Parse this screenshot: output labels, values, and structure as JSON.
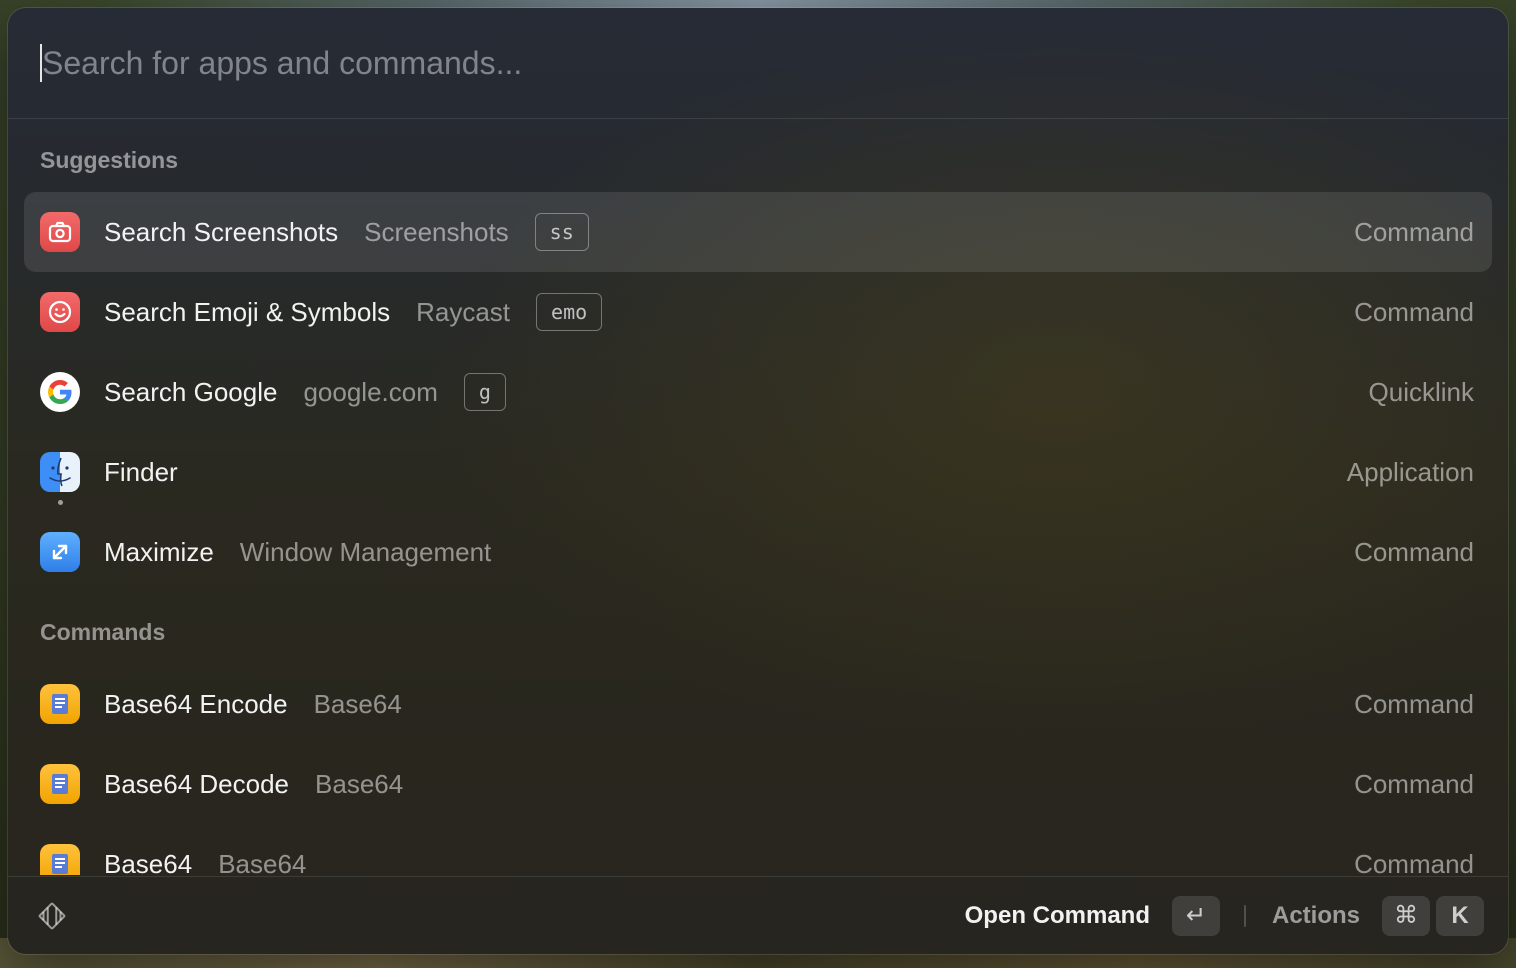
{
  "search": {
    "placeholder": "Search for apps and commands..."
  },
  "sections": {
    "suggestions_title": "Suggestions",
    "commands_title": "Commands"
  },
  "suggestions": [
    {
      "title": "Search Screenshots",
      "subtitle": "Screenshots",
      "alias": "ss",
      "kind": "Command",
      "icon": "camera-icon"
    },
    {
      "title": "Search Emoji & Symbols",
      "subtitle": "Raycast",
      "alias": "emo",
      "kind": "Command",
      "icon": "smiley-icon"
    },
    {
      "title": "Search Google",
      "subtitle": "google.com",
      "alias": "g",
      "kind": "Quicklink",
      "icon": "google-icon"
    },
    {
      "title": "Finder",
      "subtitle": "",
      "alias": "",
      "kind": "Application",
      "icon": "finder-icon"
    },
    {
      "title": "Maximize",
      "subtitle": "Window Management",
      "alias": "",
      "kind": "Command",
      "icon": "maximize-icon"
    }
  ],
  "commands": [
    {
      "title": "Base64 Encode",
      "subtitle": "Base64",
      "kind": "Command",
      "icon": "base64-icon"
    },
    {
      "title": "Base64 Decode",
      "subtitle": "Base64",
      "kind": "Command",
      "icon": "base64-icon"
    },
    {
      "title": "Base64",
      "subtitle": "Base64",
      "kind": "Command",
      "icon": "base64-icon"
    }
  ],
  "footer": {
    "primary_action": "Open Command",
    "enter_key": "↵",
    "actions_label": "Actions",
    "cmd_key": "⌘",
    "k_key": "K"
  },
  "colors": {
    "selected_row": "#ffffff1a",
    "icon_red": "#e95656",
    "icon_blue": "#3f8ef0",
    "icon_base64": "#f7b21c"
  }
}
